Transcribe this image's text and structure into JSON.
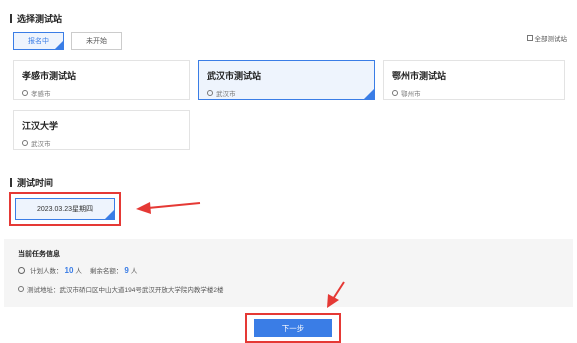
{
  "station_section": {
    "title": "选择测试站"
  },
  "filters": [
    {
      "label": "报名中",
      "active": true
    },
    {
      "label": "未开始",
      "active": false
    }
  ],
  "all_stations_label": "全部测试站",
  "stations": [
    {
      "name": "孝感市测试站",
      "city": "孝感市",
      "selected": false
    },
    {
      "name": "武汉市测试站",
      "city": "武汉市",
      "selected": true
    },
    {
      "name": "鄂州市测试站",
      "city": "鄂州市",
      "selected": false
    },
    {
      "name": "江汉大学",
      "city": "武汉市",
      "selected": false
    }
  ],
  "time_section": {
    "title": "测试时间"
  },
  "selected_date": "2023.03.23星期四",
  "task_info": {
    "title": "当前任务信息",
    "planned_label": "计划人数：",
    "planned_value": "10",
    "remaining_label": "剩余名额：",
    "remaining_value": "9",
    "unit": "人",
    "address": "测试地址：武汉市硚口区中山大道194号武汉开放大学院内教学楼2楼"
  },
  "next_button": "下一步",
  "colors": {
    "accent": "#3a7de6",
    "highlight": "#e53935"
  }
}
